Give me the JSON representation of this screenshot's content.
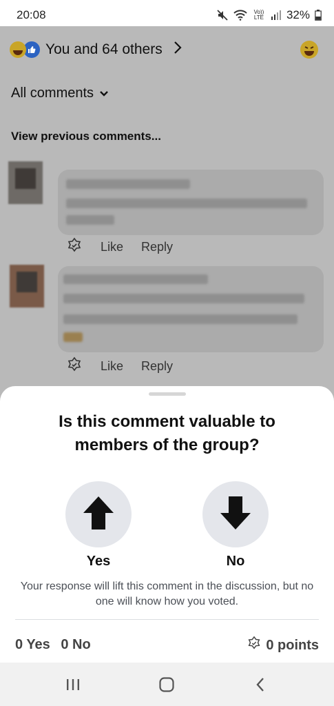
{
  "status": {
    "time": "20:08",
    "battery": "32%",
    "volte": "Vo)) LTE"
  },
  "colors": {
    "accent_like": "#2c63c2",
    "sheet_bg": "#ffffff",
    "overlay": "#9a9a9a"
  },
  "post": {
    "reactions_text": "You and 64 others",
    "filter_label": "All comments",
    "view_previous": "View previous comments...",
    "comments": [
      {
        "like_label": "Like",
        "reply_label": "Reply"
      },
      {
        "like_label": "Like",
        "reply_label": "Reply"
      }
    ]
  },
  "sheet": {
    "question": "Is this comment valuable to members of the group?",
    "yes_label": "Yes",
    "no_label": "No",
    "note": "Your response will lift this comment in the discussion, but no one will know how you voted.",
    "yes_count": "0 Yes",
    "no_count": "0 No",
    "points": "0 points"
  },
  "icons": [
    "mute-icon",
    "wifi-icon",
    "signal-icon",
    "battery-icon",
    "haha-emoji-icon",
    "like-reaction-icon",
    "chevron-right-icon",
    "chevron-down-icon",
    "badge-icon",
    "arrow-up-icon",
    "arrow-down-icon",
    "recents-icon",
    "home-icon",
    "back-icon"
  ]
}
